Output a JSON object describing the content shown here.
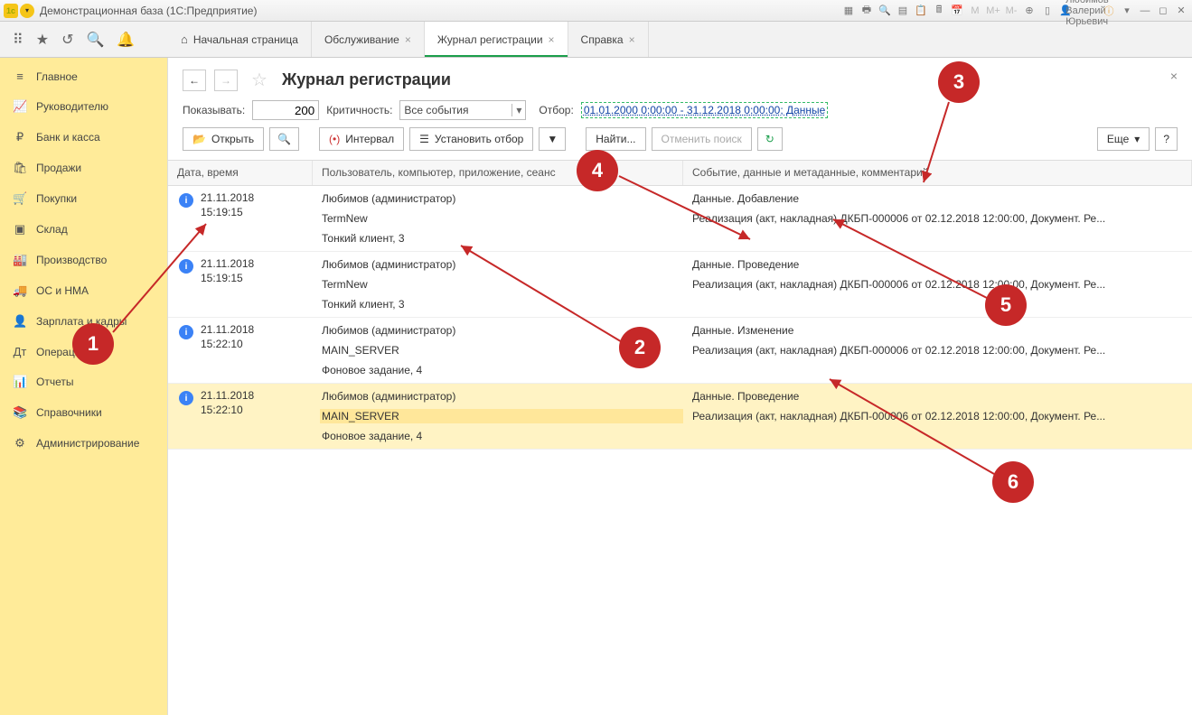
{
  "titlebar": {
    "title": "Демонстрационная база  (1С:Предприятие)",
    "username": "Любимов Валерий Юрьевич"
  },
  "top_icons": [
    "apps",
    "star",
    "history",
    "search",
    "bell"
  ],
  "tabs": {
    "home": "Начальная страница",
    "t1": "Обслуживание",
    "t2": "Журнал регистрации",
    "t3": "Справка"
  },
  "sidebar": {
    "items": [
      {
        "icon": "≡",
        "label": "Главное"
      },
      {
        "icon": "📈",
        "label": "Руководителю"
      },
      {
        "icon": "₽",
        "label": "Банк и касса"
      },
      {
        "icon": "🛍",
        "label": "Продажи"
      },
      {
        "icon": "🛒",
        "label": "Покупки"
      },
      {
        "icon": "▣",
        "label": "Склад"
      },
      {
        "icon": "🏭",
        "label": "Производство"
      },
      {
        "icon": "🚚",
        "label": "ОС и НМА"
      },
      {
        "icon": "👤",
        "label": "Зарплата и кадры"
      },
      {
        "icon": "Дт",
        "label": "Операции"
      },
      {
        "icon": "📊",
        "label": "Отчеты"
      },
      {
        "icon": "📚",
        "label": "Справочники"
      },
      {
        "icon": "⚙",
        "label": "Администрирование"
      }
    ]
  },
  "page": {
    "title": "Журнал регистрации",
    "show_label": "Показывать:",
    "show_value": "200",
    "crit_label": "Критичность:",
    "crit_value": "Все события",
    "filter_label": "Отбор:",
    "filter_value": "01.01.2000 0:00:00 - 31.12.2018 0:00:00; Данные"
  },
  "buttons": {
    "open": "Открыть",
    "interval": "Интервал",
    "setfilter": "Установить отбор",
    "find": "Найти...",
    "cancel": "Отменить поиск",
    "more": "Еще"
  },
  "columns": {
    "c1": "Дата, время",
    "c2": "Пользователь, компьютер, приложение, сеанс",
    "c3": "Событие, данные и метаданные, комментарий"
  },
  "rows": [
    {
      "date": "21.11.2018",
      "time": "15:19:15",
      "u1": "Любимов (администратор)",
      "u2": "TermNew",
      "u3": "Тонкий клиент, 3",
      "e1": "Данные. Добавление",
      "e2": "Реализация (акт, накладная) ДКБП-000006 от 02.12.2018 12:00:00, Документ. Ре..."
    },
    {
      "date": "21.11.2018",
      "time": "15:19:15",
      "u1": "Любимов (администратор)",
      "u2": "TermNew",
      "u3": "Тонкий клиент, 3",
      "e1": "Данные. Проведение",
      "e2": "Реализация (акт, накладная) ДКБП-000006 от 02.12.2018 12:00:00, Документ. Ре..."
    },
    {
      "date": "21.11.2018",
      "time": "15:22:10",
      "u1": "Любимов (администратор)",
      "u2": "MAIN_SERVER",
      "u3": "Фоновое задание, 4",
      "e1": "Данные. Изменение",
      "e2": "Реализация (акт, накладная) ДКБП-000006 от 02.12.2018 12:00:00, Документ. Ре..."
    },
    {
      "date": "21.11.2018",
      "time": "15:22:10",
      "u1": "Любимов (администратор)",
      "u2": "MAIN_SERVER",
      "u3": "Фоновое задание, 4",
      "e1": "Данные. Проведение",
      "e2": "Реализация (акт, накладная) ДКБП-000006 от 02.12.2018 12:00:00, Документ. Ре..."
    }
  ],
  "markers": {
    "1": "1",
    "2": "2",
    "3": "3",
    "4": "4",
    "5": "5",
    "6": "6"
  }
}
